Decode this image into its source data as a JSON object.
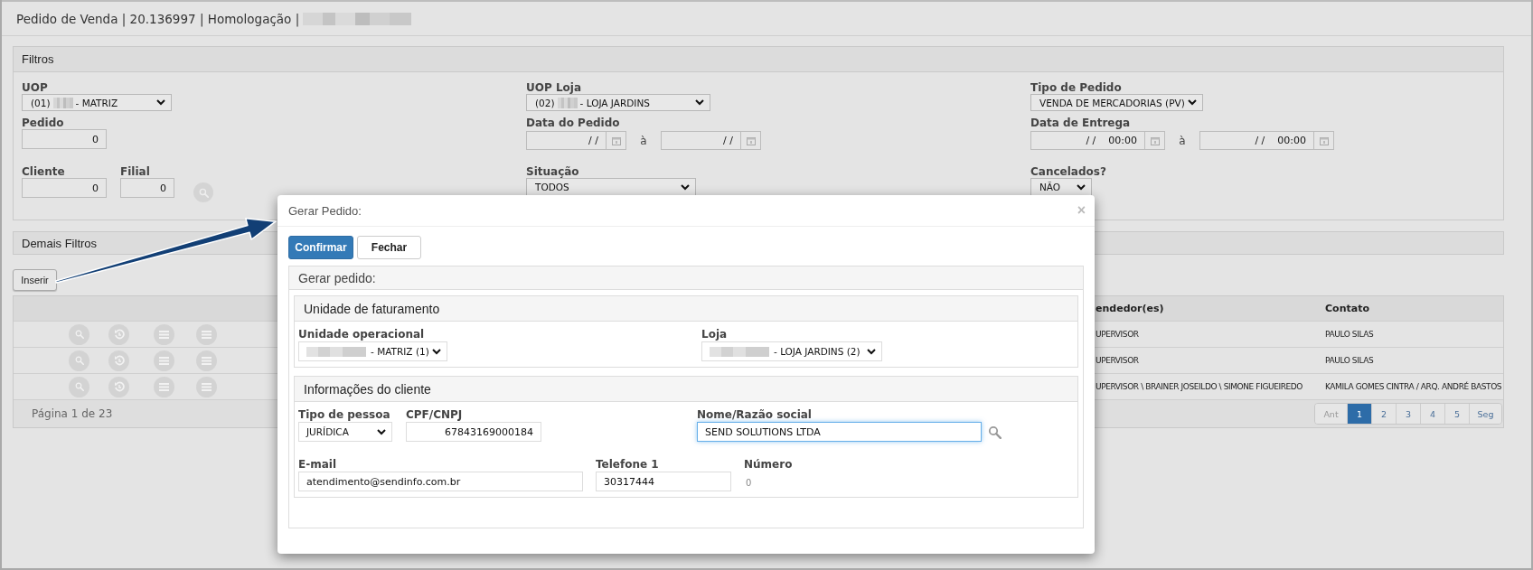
{
  "page": {
    "title": "Pedido de Venda | 20.136997 | Homologação |",
    "title_redacted": true
  },
  "filters": {
    "title": "Filtros",
    "columns": [
      [
        {
          "kind": "select",
          "label": "UOP",
          "prefix": "(01)",
          "redacted": true,
          "value": "- MATRIZ"
        },
        {
          "kind": "number_input",
          "label": "Pedido",
          "value": "0"
        },
        {
          "kind": "group",
          "items": [
            {
              "kind": "number_input",
              "label": "Cliente",
              "value": "0"
            },
            {
              "kind": "number_input",
              "label": "Filial",
              "value": "0"
            },
            {
              "kind": "search_button"
            }
          ]
        }
      ],
      [
        {
          "kind": "select",
          "label": "UOP Loja",
          "prefix": "(02)",
          "redacted": true,
          "value": "- LOJA JARDINS"
        },
        {
          "kind": "date_range",
          "label": "Data do Pedido",
          "from": "/ /",
          "separator": "à",
          "to": "/ /"
        },
        {
          "kind": "select",
          "label": "Situação",
          "value": "TODOS"
        }
      ],
      [
        {
          "kind": "select",
          "label": "Tipo de Pedido",
          "value": "VENDA DE MERCADORIAS (PV)"
        },
        {
          "kind": "date_range",
          "label": "Data de Entrega",
          "from": "/ /",
          "from_time": "00:00",
          "separator": "à",
          "to": "/ /",
          "to_time": "00:00"
        },
        {
          "kind": "select",
          "label": "Cancelados?",
          "value": "NÃO"
        }
      ]
    ]
  },
  "more_filters": {
    "title": "Demais Filtros"
  },
  "insert_button": "Inserir",
  "table": {
    "columns": [
      "endedor(es)",
      "Contato"
    ],
    "rows": [
      {
        "cells": [
          "UPERVISOR",
          "PAULO SILAS"
        ]
      },
      {
        "cells": [
          "UPERVISOR",
          "PAULO SILAS"
        ]
      },
      {
        "cells": [
          "UPERVISOR \\ BRAINER JOSEILDO \\ SIMONE FIGUEIREDO",
          "KAMILA GOMES CINTRA / ARQ. ANDRÉ BASTOS"
        ]
      }
    ],
    "footer": "Página 1 de 23",
    "pages": [
      {
        "label": "Ant",
        "selected": false,
        "disabled": true
      },
      {
        "label": "1",
        "selected": true,
        "disabled": false
      },
      {
        "label": "2",
        "selected": false,
        "disabled": false
      },
      {
        "label": "3",
        "selected": false,
        "disabled": false
      },
      {
        "label": "4",
        "selected": false,
        "disabled": false
      },
      {
        "label": "5",
        "selected": false,
        "disabled": false
      },
      {
        "label": "Seg",
        "selected": false,
        "disabled": false
      }
    ]
  },
  "dialog": {
    "title": "Gerar Pedido:",
    "close": "×",
    "buttons": [
      {
        "label": "Confirmar",
        "kind": "primary"
      },
      {
        "label": "Fechar",
        "kind": "default"
      }
    ],
    "panel_title": "Gerar pedido:",
    "sections": [
      {
        "title": "Unidade de faturamento",
        "rows": [
          [
            {
              "kind": "select",
              "label": "Unidade operacional",
              "redacted": true,
              "value": "- MATRIZ (1)"
            },
            {
              "kind": "select",
              "label": "Loja",
              "redacted": true,
              "value": "- LOJA JARDINS (2)"
            }
          ]
        ]
      },
      {
        "title": "Informações do cliente",
        "rows": [
          [
            {
              "kind": "select",
              "label": "Tipo de pessoa",
              "value": "JURÍDICA"
            },
            {
              "kind": "number_input",
              "label": "CPF/CNPJ",
              "value": "67843169000184"
            },
            {
              "kind": "input",
              "label": "Nome/Razão social",
              "value": "SEND SOLUTIONS LTDA",
              "focused": true,
              "search": true
            }
          ],
          [
            {
              "kind": "input",
              "label": "E-mail",
              "value": "atendimento@sendinfo.com.br"
            },
            {
              "kind": "input",
              "label": "Telefone 1",
              "value": "30317444"
            },
            {
              "kind": "text",
              "label": "Número",
              "value": "0"
            }
          ]
        ]
      }
    ]
  }
}
